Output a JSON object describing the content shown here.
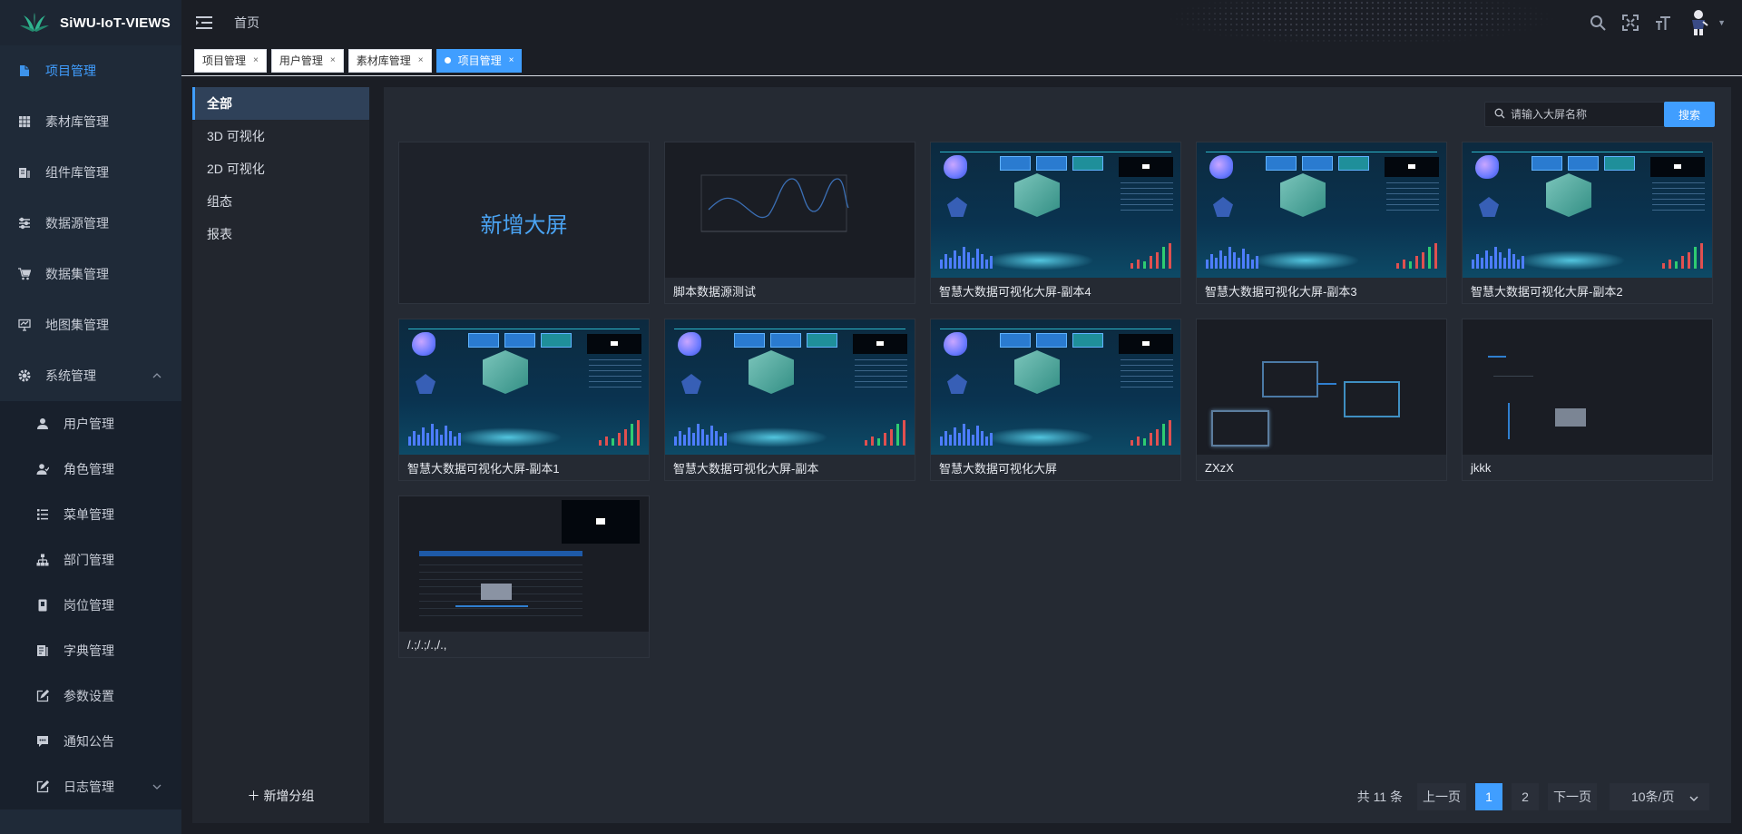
{
  "app": {
    "logo_text": "SiWU-IoT-VIEWS"
  },
  "header": {
    "breadcrumb": "首页"
  },
  "sidebar": {
    "items": [
      {
        "label": "项目管理",
        "icon": "file-icon",
        "active": true
      },
      {
        "label": "素材库管理",
        "icon": "grid-icon"
      },
      {
        "label": "组件库管理",
        "icon": "doc-icon"
      },
      {
        "label": "数据源管理",
        "icon": "sliders-icon"
      },
      {
        "label": "数据集管理",
        "icon": "cart-icon"
      },
      {
        "label": "地图集管理",
        "icon": "monitor-icon"
      },
      {
        "label": "系统管理",
        "icon": "gear-icon",
        "expanded": true
      }
    ],
    "sub_items": [
      {
        "label": "用户管理",
        "icon": "user-icon"
      },
      {
        "label": "角色管理",
        "icon": "users-icon"
      },
      {
        "label": "菜单管理",
        "icon": "list-icon"
      },
      {
        "label": "部门管理",
        "icon": "org-icon"
      },
      {
        "label": "岗位管理",
        "icon": "post-icon"
      },
      {
        "label": "字典管理",
        "icon": "book-icon"
      },
      {
        "label": "参数设置",
        "icon": "edit-icon"
      },
      {
        "label": "通知公告",
        "icon": "message-icon"
      },
      {
        "label": "日志管理",
        "icon": "log-icon"
      }
    ]
  },
  "tags": [
    {
      "label": "项目管理"
    },
    {
      "label": "用户管理"
    },
    {
      "label": "素材库管理"
    },
    {
      "label": "项目管理",
      "active": true
    }
  ],
  "groups": {
    "items": [
      "全部",
      "3D 可视化",
      "2D 可视化",
      "组态",
      "报表"
    ],
    "active_index": 0,
    "add_label": "新增分组"
  },
  "search": {
    "placeholder": "请输入大屏名称",
    "button": "搜索"
  },
  "cards": {
    "new_label": "新增大屏",
    "items": [
      {
        "name": "脚本数据源测试",
        "thumb": "line"
      },
      {
        "name": "智慧大数据可视化大屏-副本4",
        "thumb": "dashboard"
      },
      {
        "name": "智慧大数据可视化大屏-副本3",
        "thumb": "dashboard"
      },
      {
        "name": "智慧大数据可视化大屏-副本2",
        "thumb": "dashboard"
      },
      {
        "name": "智慧大数据可视化大屏-副本1",
        "thumb": "dashboard"
      },
      {
        "name": "智慧大数据可视化大屏-副本",
        "thumb": "dashboard"
      },
      {
        "name": "智慧大数据可视化大屏",
        "thumb": "dashboard"
      },
      {
        "name": "ZXzX",
        "thumb": "frames"
      },
      {
        "name": "jkkk",
        "thumb": "sparse"
      },
      {
        "name": "/.;/.;/.,/.,",
        "thumb": "table"
      }
    ]
  },
  "pagination": {
    "total_text": "共 11 条",
    "prev": "上一页",
    "pages": [
      "1",
      "2"
    ],
    "current": "1",
    "next": "下一页",
    "page_size": "10条/页"
  },
  "colors": {
    "accent": "#409eff",
    "bg": "#1b1e25",
    "sidebar": "#1f2a38"
  }
}
